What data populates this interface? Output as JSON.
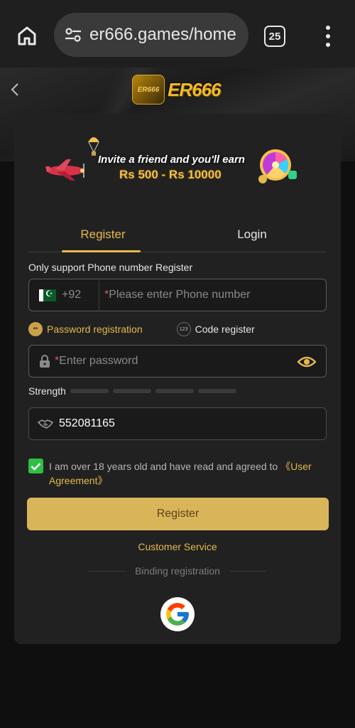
{
  "browser": {
    "url": "er666.games/home",
    "tab_count": "25"
  },
  "header": {
    "logo_badge": "ER666",
    "logo_text": "ER666"
  },
  "banner": {
    "line1": "Invite a friend and you'll earn",
    "line2": "Rs 500 - Rs 10000"
  },
  "tabs": [
    {
      "label": "Register",
      "active": true
    },
    {
      "label": "Login",
      "active": false
    }
  ],
  "form": {
    "hint": "Only support Phone number Register",
    "phone": {
      "country_code": "+92",
      "required_mark": "*",
      "placeholder": "Please enter Phone number"
    },
    "options": {
      "password_registration": "Password registration",
      "password_icon": "**",
      "code_register": "Code register",
      "code_icon": "123"
    },
    "password": {
      "required_mark": "*",
      "placeholder": "Enter password"
    },
    "strength_label": "Strength",
    "invite_code_value": "552081165",
    "agreement_text": "I am over 18 years old and have read and agreed to ",
    "agreement_link": "《User Agreement》",
    "agreement_checked": true,
    "register_button": "Register",
    "customer_service": "Customer Service",
    "binding_registration": "Binding registration"
  },
  "colors": {
    "accent": "#e5b94e",
    "button": "#d9b55a",
    "checkbox": "#2fbf45",
    "card": "#212121"
  }
}
